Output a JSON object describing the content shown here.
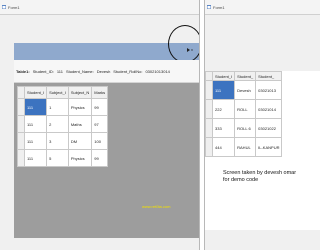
{
  "left_window": {
    "title": "Form1",
    "icon": "form-icon",
    "nav_close": "x",
    "table_strip": {
      "table_label": "Table1:",
      "field1_name": "Student_ID:",
      "field1_value": "111",
      "field2_name": "Student_Name:",
      "field2_value": "Devesh",
      "field3_name": "Student_RollNo:",
      "field3_value": "03021013014"
    },
    "grid": {
      "columns": [
        "Student_I",
        "Subject_I",
        "Subject_N",
        "Marks"
      ],
      "rows": [
        [
          "111",
          "1",
          "Physics",
          "99"
        ],
        [
          "111",
          "2",
          "Maths",
          "97"
        ],
        [
          "111",
          "3",
          "DM",
          "100"
        ],
        [
          "111",
          "5",
          "Physics",
          "99"
        ]
      ]
    },
    "watermark": "www.ret0ta.com"
  },
  "right_window": {
    "title": "Form1",
    "icon": "form-icon",
    "grid": {
      "columns": [
        "Student_I",
        "Student_",
        "Student_"
      ],
      "rows": [
        [
          "111",
          "Devesh",
          "03021013"
        ],
        [
          "222",
          "ROLL",
          "03021014"
        ],
        [
          "333",
          "ROLL 6",
          "03021022"
        ],
        [
          "444",
          "RAHUL",
          "IL-KANPUR"
        ]
      ]
    },
    "caption": "Screen taken by devesh omar for demo code"
  },
  "colors": {
    "bluebar": "#8fa9cd",
    "selection": "#3c73c0",
    "background_gray": "#9d9d9d"
  }
}
